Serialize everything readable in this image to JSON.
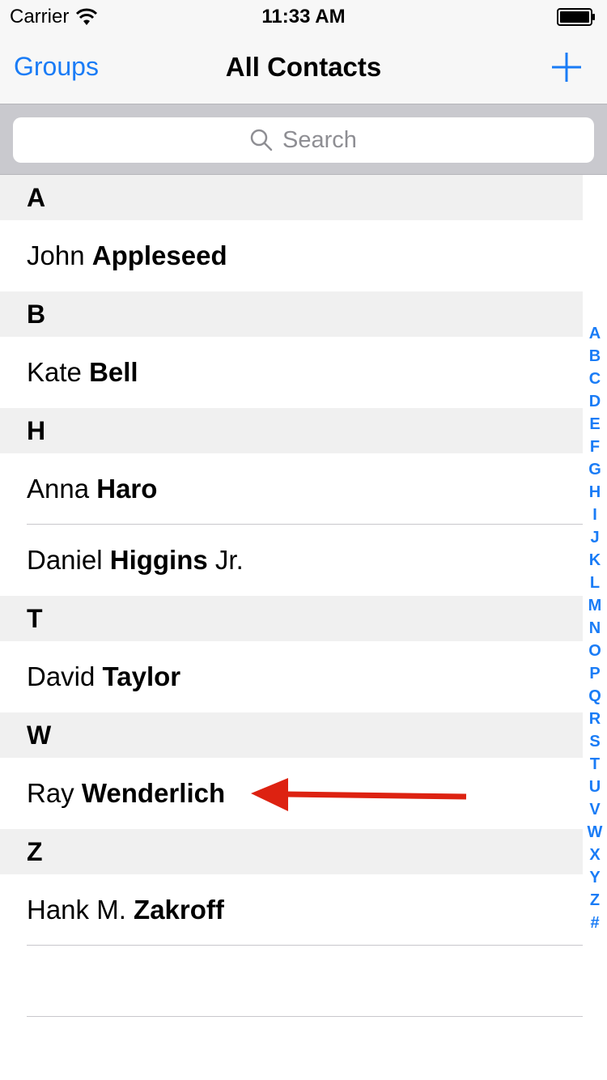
{
  "status_bar": {
    "carrier": "Carrier",
    "time": "11:33 AM"
  },
  "nav": {
    "left_button": "Groups",
    "title": "All Contacts",
    "add_icon": "plus-icon"
  },
  "search": {
    "placeholder": "Search",
    "icon": "magnifier-icon"
  },
  "sections": [
    {
      "letter": "A",
      "contacts": [
        {
          "first": "John",
          "last": "Appleseed",
          "suffix": ""
        }
      ]
    },
    {
      "letter": "B",
      "contacts": [
        {
          "first": "Kate",
          "last": "Bell",
          "suffix": ""
        }
      ]
    },
    {
      "letter": "H",
      "contacts": [
        {
          "first": "Anna",
          "last": "Haro",
          "suffix": ""
        },
        {
          "first": "Daniel",
          "last": "Higgins",
          "suffix": "Jr."
        }
      ]
    },
    {
      "letter": "T",
      "contacts": [
        {
          "first": "David",
          "last": "Taylor",
          "suffix": ""
        }
      ]
    },
    {
      "letter": "W",
      "contacts": [
        {
          "first": "Ray",
          "last": "Wenderlich",
          "suffix": ""
        }
      ]
    },
    {
      "letter": "Z",
      "contacts": [
        {
          "first": "Hank M.",
          "last": "Zakroff",
          "suffix": ""
        }
      ]
    }
  ],
  "index_letters": [
    "A",
    "B",
    "C",
    "D",
    "E",
    "F",
    "G",
    "H",
    "I",
    "J",
    "K",
    "L",
    "M",
    "N",
    "O",
    "P",
    "Q",
    "R",
    "S",
    "T",
    "U",
    "V",
    "W",
    "X",
    "Y",
    "Z",
    "#"
  ],
  "colors": {
    "tint": "#1a7cf6",
    "annotation_arrow": "#dd2211"
  }
}
